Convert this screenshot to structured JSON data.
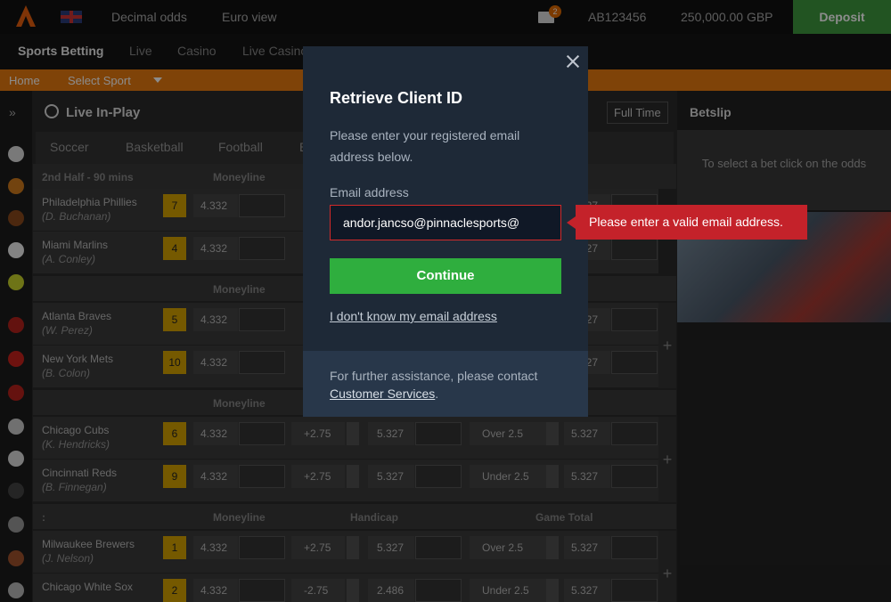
{
  "topbar": {
    "odds_format": "Decimal odds",
    "view": "Euro view",
    "unread_count": "2",
    "client_id": "AB123456",
    "balance": "250,000.00 GBP",
    "deposit_label": "Deposit"
  },
  "nav": {
    "items": [
      "Sports Betting",
      "Live",
      "Casino",
      "Live Casino"
    ]
  },
  "crumbs": {
    "home": "Home",
    "select_sport": "Select Sport"
  },
  "inplay": {
    "title": "Live In-Play",
    "full_time": "Full Time",
    "sports": [
      "Soccer",
      "Basketball",
      "Football",
      "B"
    ]
  },
  "sections": [
    {
      "period": "2nd Half - 90 mins",
      "moneyline": "Moneyline",
      "handicap": "",
      "total": "",
      "games": [
        {
          "team": "Philadelphia Phillies",
          "pitcher": "(D. Buchanan)",
          "seed": "7",
          "odd": "4.332",
          "hc": "",
          "hc_odd": "",
          "tot": "",
          "tot_odd": "5.327"
        },
        {
          "team": "Miami Marlins",
          "pitcher": "(A. Conley)",
          "seed": "4",
          "odd": "4.332",
          "hc": "",
          "hc_odd": "",
          "tot": "",
          "tot_odd": "5.327"
        }
      ]
    },
    {
      "period": "",
      "moneyline": "Moneyline",
      "handicap": "",
      "total": "",
      "games": [
        {
          "team": "Atlanta Braves",
          "pitcher": "(W. Perez)",
          "seed": "5",
          "odd": "4.332",
          "hc": "",
          "hc_odd": "",
          "tot": "",
          "tot_odd": "5.327"
        },
        {
          "team": "New York Mets",
          "pitcher": "(B. Colon)",
          "seed": "10",
          "odd": "4.332",
          "hc": "",
          "hc_odd": "",
          "tot": "",
          "tot_odd": "5.327"
        }
      ]
    },
    {
      "period": "",
      "moneyline": "Moneyline",
      "handicap": "",
      "total": "",
      "games": [
        {
          "team": "Chicago Cubs",
          "pitcher": "(K. Hendricks)",
          "seed": "6",
          "odd": "4.332",
          "hc": "+2.75",
          "hc_odd": "5.327",
          "tot": "Over 2.5",
          "tot_odd": "5.327"
        },
        {
          "team": "Cincinnati Reds",
          "pitcher": "(B. Finnegan)",
          "seed": "9",
          "odd": "4.332",
          "hc": "+2.75",
          "hc_odd": "5.327",
          "tot": "Under 2.5",
          "tot_odd": "5.327"
        }
      ]
    },
    {
      "period": ":",
      "moneyline": "Moneyline",
      "handicap": "Handicap",
      "total": "Game Total",
      "games": [
        {
          "team": "Milwaukee Brewers",
          "pitcher": "(J. Nelson)",
          "seed": "1",
          "odd": "4.332",
          "hc": "+2.75",
          "hc_odd": "5.327",
          "tot": "Over 2.5",
          "tot_odd": "5.327"
        },
        {
          "team": "Chicago White Sox",
          "pitcher": "",
          "seed": "2",
          "odd": "4.332",
          "hc": "-2.75",
          "hc_odd": "2.486",
          "tot": "Under 2.5",
          "tot_odd": "5.327"
        }
      ]
    }
  ],
  "betslip": {
    "title": "Betslip",
    "empty_text": "To select a bet click on the odds"
  },
  "modal": {
    "title": "Retrieve Client ID",
    "description": "Please enter your registered email address below.",
    "email_label": "Email address",
    "email_value": "andor.jancso@pinnaclesports@",
    "continue_label": "Continue",
    "forgot_link": "I don't know my email address",
    "footer_text": "For further assistance, please contact ",
    "footer_link": "Customer Services",
    "footer_end": ".",
    "error_message": "Please enter a valid email address."
  },
  "colors": {
    "accent_orange": "#e87a0f",
    "deposit_green": "#3f9a3f",
    "continue_green": "#2fae3e",
    "error_red": "#c4222a",
    "modal_bg": "#1e2937"
  }
}
